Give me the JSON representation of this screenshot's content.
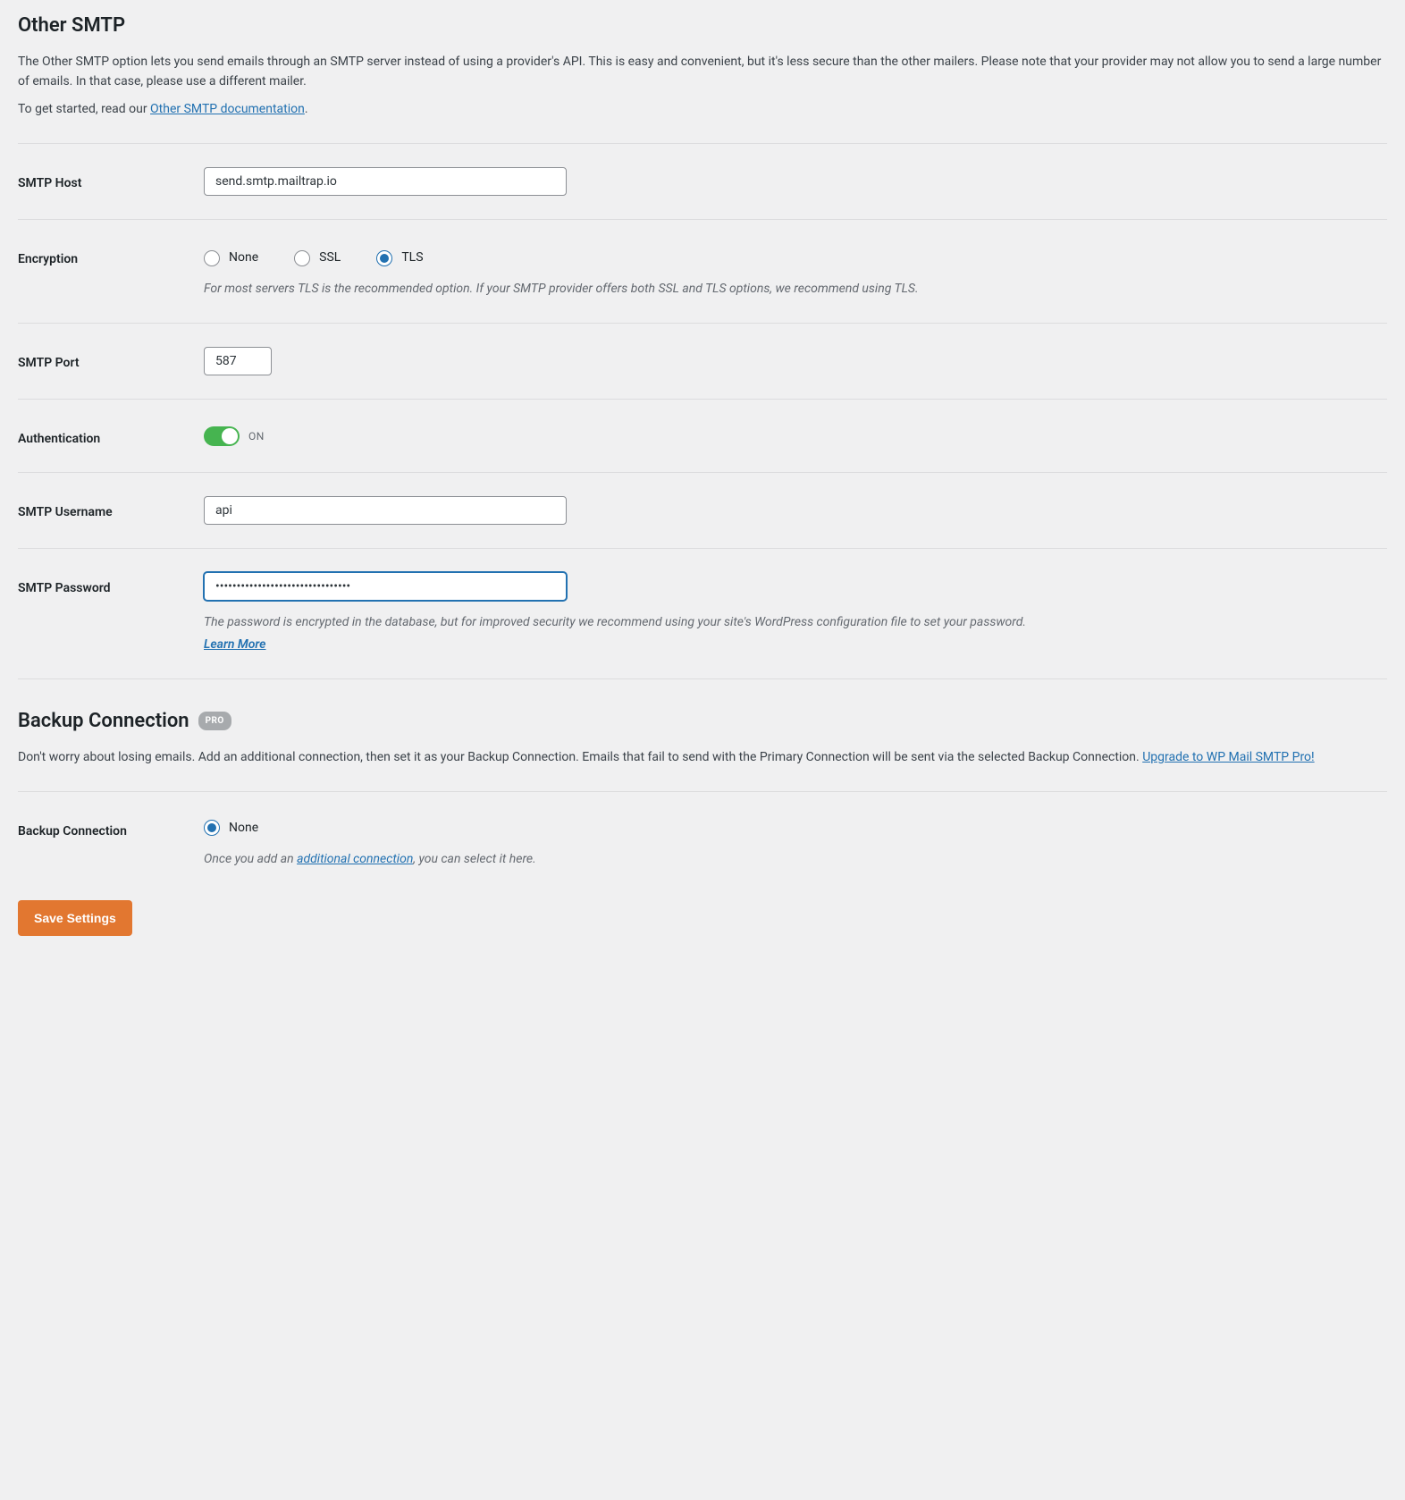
{
  "sections": {
    "other_smtp": {
      "title": "Other SMTP",
      "desc": "The Other SMTP option lets you send emails through an SMTP server instead of using a provider's API. This is easy and convenient, but it's less secure than the other mailers. Please note that your provider may not allow you to send a large number of emails. In that case, please use a different mailer.",
      "get_started_prefix": "To get started, read our ",
      "doc_link_text": "Other SMTP documentation",
      "get_started_suffix": "."
    },
    "backup": {
      "title": "Backup Connection",
      "badge": "PRO",
      "desc_prefix": "Don't worry about losing emails. Add an additional connection, then set it as your Backup Connection. Emails that fail to send with the Primary Connection will be sent via the selected Backup Connection. ",
      "upgrade_link": "Upgrade to WP Mail SMTP Pro!"
    }
  },
  "fields": {
    "smtp_host": {
      "label": "SMTP Host",
      "value": "send.smtp.mailtrap.io"
    },
    "encryption": {
      "label": "Encryption",
      "options": {
        "none": "None",
        "ssl": "SSL",
        "tls": "TLS"
      },
      "selected": "tls",
      "help": "For most servers TLS is the recommended option. If your SMTP provider offers both SSL and TLS options, we recommend using TLS."
    },
    "smtp_port": {
      "label": "SMTP Port",
      "value": "587"
    },
    "authentication": {
      "label": "Authentication",
      "state_text": "ON",
      "on": true
    },
    "smtp_username": {
      "label": "SMTP Username",
      "value": "api"
    },
    "smtp_password": {
      "label": "SMTP Password",
      "value": "••••••••••••••••••••••••••••••••",
      "help_prefix": "The password is encrypted in the database, but for improved security we recommend using your site's WordPress configuration file to set your password.",
      "learn_more": "Learn More"
    },
    "backup_connection": {
      "label": "Backup Connection",
      "option_none": "None",
      "help_prefix": "Once you add an ",
      "help_link": "additional connection",
      "help_suffix": ", you can select it here."
    }
  },
  "buttons": {
    "save": "Save Settings"
  }
}
